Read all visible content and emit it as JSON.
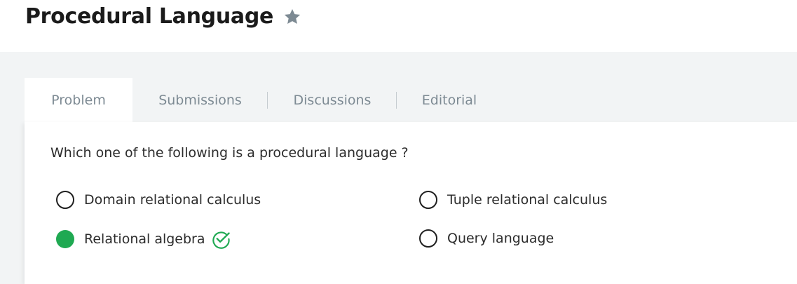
{
  "header": {
    "title": "Procedural Language"
  },
  "tabs": [
    {
      "label": "Problem",
      "active": true
    },
    {
      "label": "Submissions",
      "active": false
    },
    {
      "label": "Discussions",
      "active": false
    },
    {
      "label": "Editorial",
      "active": false
    }
  ],
  "question": {
    "text": "Which one of the following is a procedural language ?"
  },
  "options": [
    {
      "label": "Domain relational calculus",
      "selected": false,
      "correct": false
    },
    {
      "label": "Tuple relational calculus",
      "selected": false,
      "correct": false
    },
    {
      "label": "Relational algebra",
      "selected": true,
      "correct": true
    },
    {
      "label": "Query language",
      "selected": false,
      "correct": false
    }
  ],
  "colors": {
    "correct": "#1fa952",
    "star": "#7d8a93",
    "tab_text": "#7d8a93",
    "band": "#f2f4f5"
  },
  "icons": {
    "favorite": "star-icon",
    "correct": "check-circle-icon"
  }
}
